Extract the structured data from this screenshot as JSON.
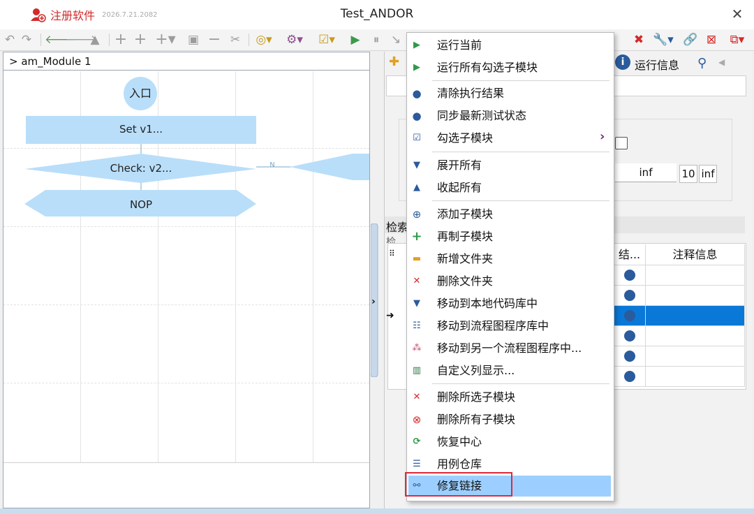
{
  "titlebar": {
    "register_label": "注册软件",
    "version": "2026.7.21.2082",
    "title": "Test_ANDOR",
    "close_glyph": "✕"
  },
  "left_pane": {
    "header": "> am_Module 1",
    "nodes": {
      "entry": "入口",
      "set": "Set v1...",
      "check": "Check: v2...",
      "branch_label": "N",
      "nop": "NOP"
    }
  },
  "right_pane": {
    "tab_run_info": "运行信息",
    "inf_value": "inf",
    "count_value": "10",
    "inf_button": "inf",
    "search_label": "检索",
    "search_sub": "检",
    "col_result": "结...",
    "col_comment": "注释信息"
  },
  "context_menu": {
    "items": [
      {
        "label": "运行当前",
        "icon": "play-icon"
      },
      {
        "label": "运行所有勾选子模块",
        "icon": "play-icon"
      },
      {
        "label": "清除执行结果",
        "icon": "dot-icon"
      },
      {
        "label": "同步最新测试状态",
        "icon": "dot-icon"
      },
      {
        "label": "勾选子模块",
        "icon": "checkbox-icon"
      },
      {
        "label": "展开所有",
        "icon": "triangle-down-icon"
      },
      {
        "label": "收起所有",
        "icon": "triangle-up-icon"
      },
      {
        "label": "添加子模块",
        "icon": "plus-circle-icon"
      },
      {
        "label": "再制子模块",
        "icon": "plus-icon"
      },
      {
        "label": "新增文件夹",
        "icon": "folder-icon"
      },
      {
        "label": "删除文件夹",
        "icon": "x-icon"
      },
      {
        "label": "移动到本地代码库中",
        "icon": "triangle-down-icon"
      },
      {
        "label": "移动到流程图程序库中",
        "icon": "flowchart-icon"
      },
      {
        "label": "移动到另一个流程图程序中...",
        "icon": "network-icon"
      },
      {
        "label": "自定义列显示...",
        "icon": "columns-icon"
      },
      {
        "label": "删除所选子模块",
        "icon": "x-icon"
      },
      {
        "label": "删除所有子模块",
        "icon": "x-circle-icon"
      },
      {
        "label": "恢复中心",
        "icon": "refresh-icon"
      },
      {
        "label": "用例仓库",
        "icon": "database-icon"
      },
      {
        "label": "修复链接",
        "icon": "link-icon"
      }
    ],
    "submenu_arrow": "›"
  },
  "colors": {
    "accent_red": "#d42a2a",
    "highlight": "#9ccfff",
    "selected_row": "#0a78d7",
    "node_fill": "#b9def9",
    "dot_blue": "#2a5b9c"
  }
}
